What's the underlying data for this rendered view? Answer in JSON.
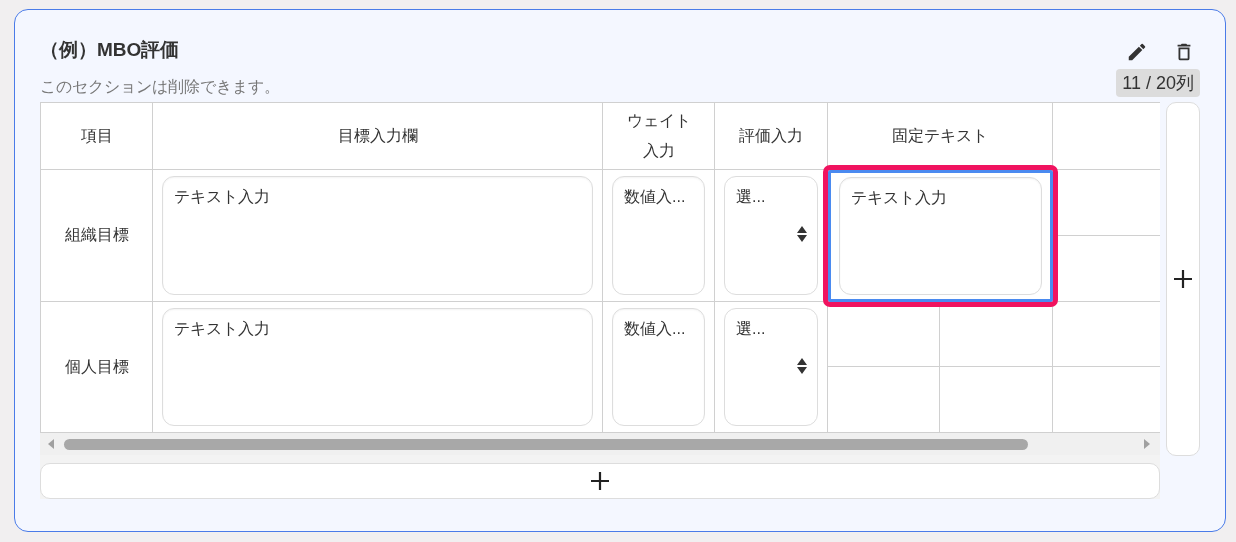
{
  "section": {
    "title": "（例）MBO評価",
    "description": "このセクションは削除できます。",
    "column_count": "11 / 20列"
  },
  "table": {
    "columns": [
      "項目",
      "目標入力欄",
      "ウェイト入力",
      "評価入力",
      "固定テキスト"
    ],
    "rows": [
      {
        "cells": [
          {
            "kind": "label",
            "text": "組織目標",
            "selected": false
          },
          {
            "kind": "text",
            "placeholder": "テキスト入力",
            "selected": false
          },
          {
            "kind": "number",
            "placeholder": "数値入...",
            "selected": false
          },
          {
            "kind": "select",
            "value": "選...",
            "selected": false
          },
          {
            "kind": "text",
            "placeholder": "テキスト入力",
            "selected": true
          }
        ]
      },
      {
        "cells": [
          {
            "kind": "label",
            "text": "個人目標",
            "selected": false
          },
          {
            "kind": "text",
            "placeholder": "テキスト入力",
            "selected": false
          },
          {
            "kind": "number",
            "placeholder": "数値入...",
            "selected": false
          },
          {
            "kind": "select",
            "value": "選...",
            "selected": false
          },
          {
            "kind": "empty",
            "selected": false
          }
        ]
      }
    ]
  }
}
